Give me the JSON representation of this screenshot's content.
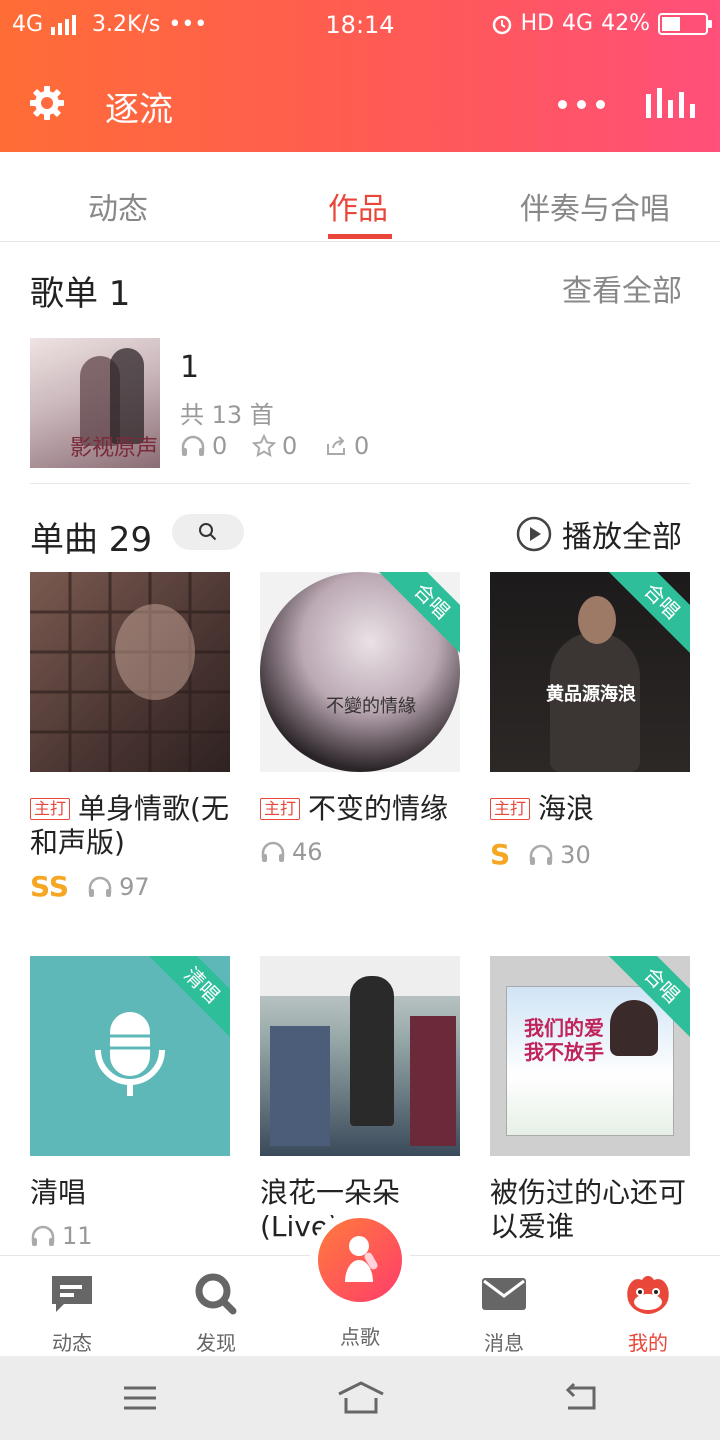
{
  "status": {
    "network": "4G",
    "speed": "3.2K/s",
    "dots": "•••",
    "time": "18:14",
    "hd": "HD",
    "net2": "4G",
    "battery_percent": 42,
    "battery_label": "42%"
  },
  "appbar": {
    "title": "逐流"
  },
  "tabs": [
    {
      "label": "动态"
    },
    {
      "label": "作品"
    },
    {
      "label": "伴奏与合唱"
    }
  ],
  "playlist_section": {
    "title": "歌单 1",
    "view_all": "查看全部",
    "cover_text": "影视原声",
    "name": "1",
    "count": "共 13 首",
    "plays": "0",
    "favorites": "0",
    "shares": "0"
  },
  "songs_section": {
    "title": "单曲 29",
    "play_all": "播放全部"
  },
  "songs": [
    {
      "title": "单身情歌(无和声版)",
      "tag": "主打",
      "score": "SS",
      "plays": "97",
      "ribbon": ""
    },
    {
      "title": "不变的情缘",
      "tag": "主打",
      "score": "",
      "plays": "46",
      "ribbon": "合唱",
      "cover_text": "不變的情緣"
    },
    {
      "title": "海浪",
      "tag": "主打",
      "score": "S",
      "plays": "30",
      "ribbon": "合唱",
      "cover_text": "黄品源海浪"
    },
    {
      "title": "清唱",
      "tag": "",
      "score": "",
      "plays": "11",
      "ribbon": "清唱"
    },
    {
      "title": "浪花一朵朵(Live)",
      "tag": "",
      "score": "",
      "plays": "",
      "ribbon": ""
    },
    {
      "title": "被伤过的心还可以爱谁",
      "tag": "",
      "score": "",
      "plays": "",
      "ribbon": "合唱",
      "cover_text": "我们的爱我不放手"
    }
  ],
  "bottom_nav": [
    {
      "label": "动态"
    },
    {
      "label": "发现"
    },
    {
      "label": "点歌"
    },
    {
      "label": "消息"
    },
    {
      "label": "我的"
    }
  ],
  "colors": {
    "accent": "#e8473a",
    "ribbon": "#2fbe9a",
    "score": "#f5a623"
  }
}
